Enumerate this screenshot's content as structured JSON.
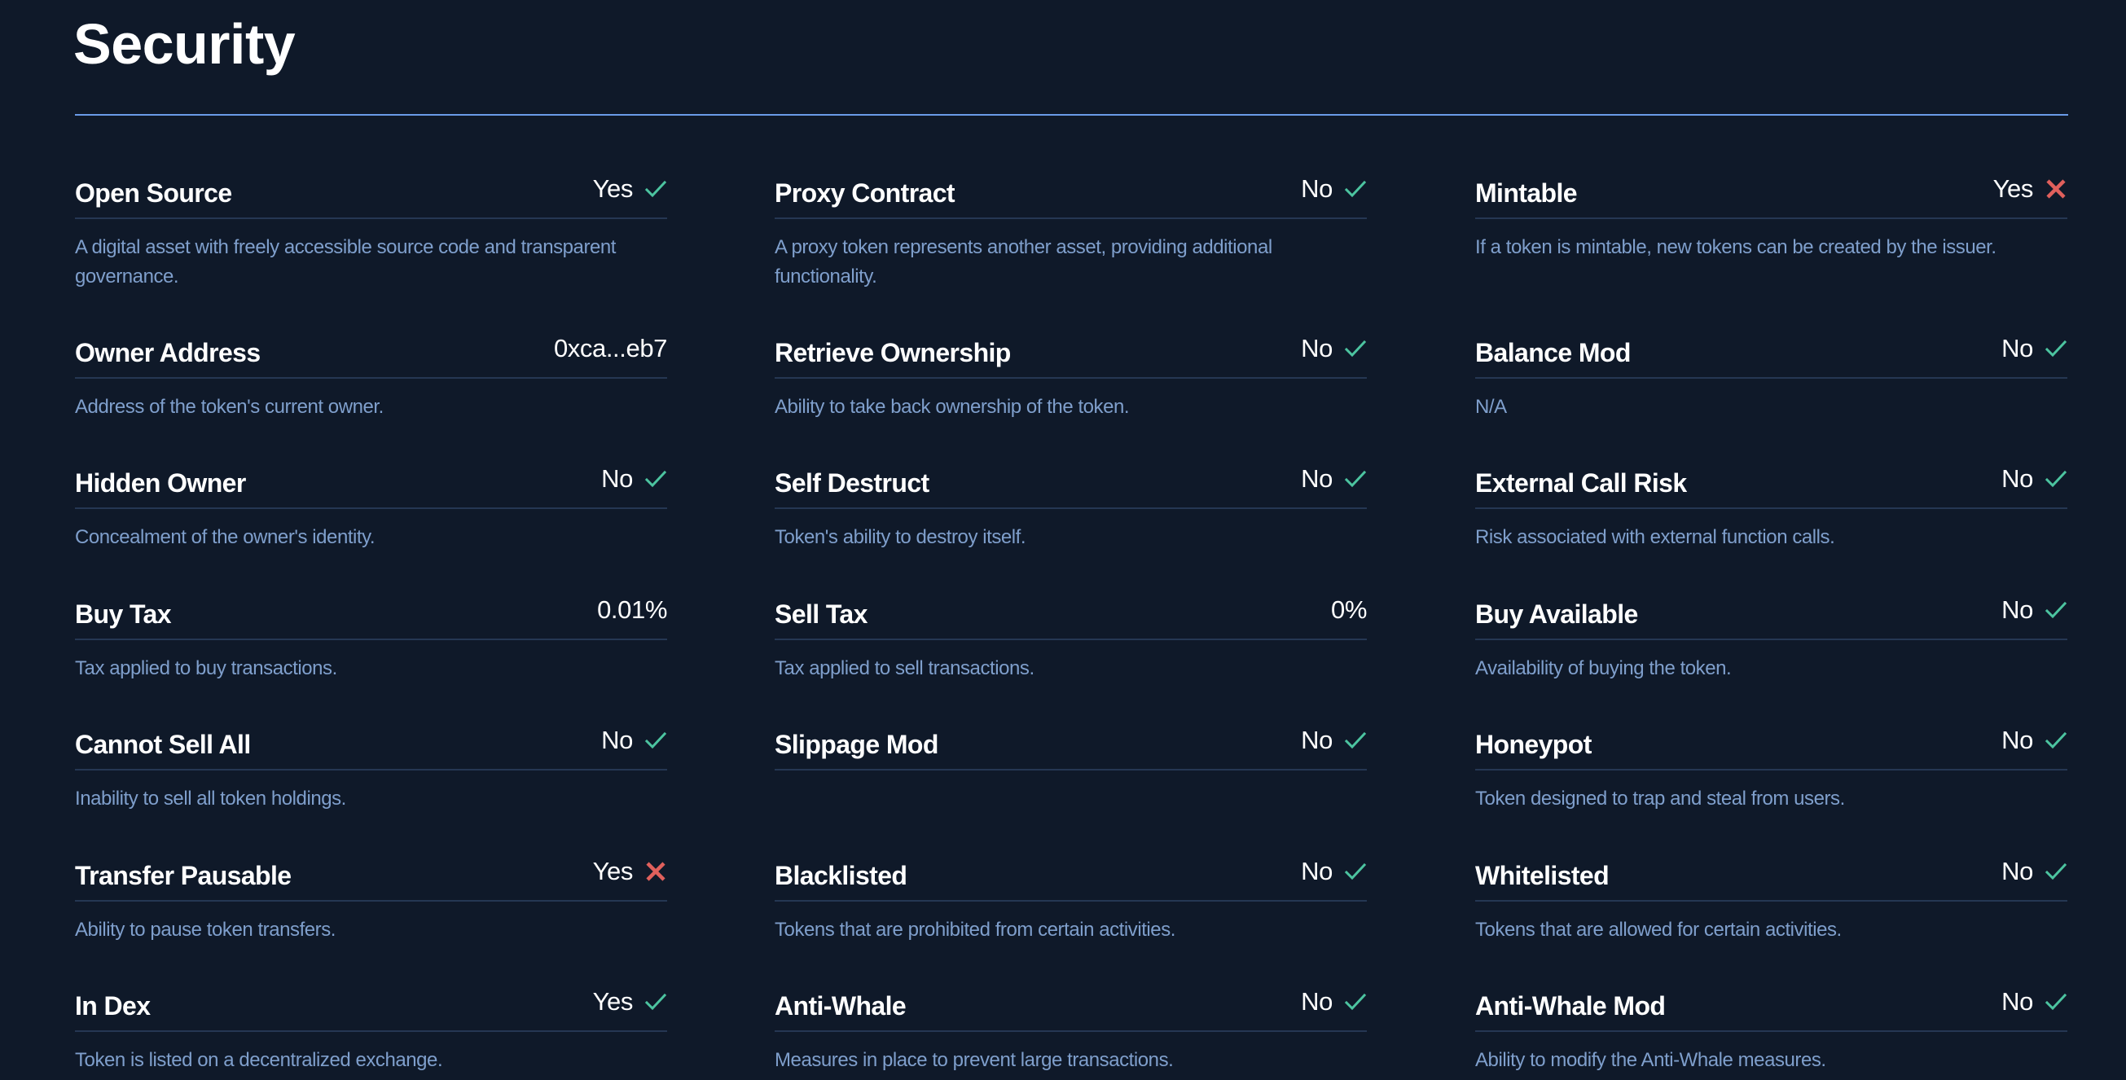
{
  "page": {
    "title": "Security"
  },
  "colors": {
    "background": "#0f1929",
    "accent_rule": "#6a9be8",
    "divider": "#253753",
    "label": "#ffffff",
    "description": "#7f9fcc",
    "pass": "#4cc4a0",
    "fail": "#e0605c"
  },
  "columns": [
    {
      "items": [
        {
          "label": "Open Source",
          "value": "Yes",
          "status": "pass",
          "icon": "check-icon",
          "description": "A digital asset with freely accessible source code and transparent governance."
        },
        {
          "label": "Owner Address",
          "value": "0xca...eb7",
          "status": "none",
          "icon": "",
          "description": "Address of the token's current owner."
        },
        {
          "label": "Hidden Owner",
          "value": "No",
          "status": "pass",
          "icon": "check-icon",
          "description": "Concealment of the owner's identity."
        },
        {
          "label": "Buy Tax",
          "value": "0.01%",
          "status": "none",
          "icon": "",
          "description": "Tax applied to buy transactions."
        },
        {
          "label": "Cannot Sell All",
          "value": "No",
          "status": "pass",
          "icon": "check-icon",
          "description": "Inability to sell all token holdings."
        },
        {
          "label": "Transfer Pausable",
          "value": "Yes",
          "status": "fail",
          "icon": "x-icon",
          "description": "Ability to pause token transfers."
        },
        {
          "label": "In Dex",
          "value": "Yes",
          "status": "pass",
          "icon": "check-icon",
          "description": "Token is listed on a decentralized exchange."
        }
      ]
    },
    {
      "items": [
        {
          "label": "Proxy Contract",
          "value": "No",
          "status": "pass",
          "icon": "check-icon",
          "description": "A proxy token represents another asset, providing additional functionality."
        },
        {
          "label": "Retrieve Ownership",
          "value": "No",
          "status": "pass",
          "icon": "check-icon",
          "description": "Ability to take back ownership of the token."
        },
        {
          "label": "Self Destruct",
          "value": "No",
          "status": "pass",
          "icon": "check-icon",
          "description": "Token's ability to destroy itself."
        },
        {
          "label": "Sell Tax",
          "value": "0%",
          "status": "none",
          "icon": "",
          "description": "Tax applied to sell transactions."
        },
        {
          "label": "Slippage Mod",
          "value": "No",
          "status": "pass",
          "icon": "check-icon",
          "description": ""
        },
        {
          "label": "Blacklisted",
          "value": "No",
          "status": "pass",
          "icon": "check-icon",
          "description": "Tokens that are prohibited from certain activities."
        },
        {
          "label": "Anti-Whale",
          "value": "No",
          "status": "pass",
          "icon": "check-icon",
          "description": "Measures in place to prevent large transactions."
        }
      ]
    },
    {
      "items": [
        {
          "label": "Mintable",
          "value": "Yes",
          "status": "fail",
          "icon": "x-icon",
          "description": "If a token is mintable, new tokens can be created by the issuer."
        },
        {
          "label": "Balance Mod",
          "value": "No",
          "status": "pass",
          "icon": "check-icon",
          "description": "N/A"
        },
        {
          "label": "External Call Risk",
          "value": "No",
          "status": "pass",
          "icon": "check-icon",
          "description": "Risk associated with external function calls."
        },
        {
          "label": "Buy Available",
          "value": "No",
          "status": "pass",
          "icon": "check-icon",
          "description": "Availability of buying the token."
        },
        {
          "label": "Honeypot",
          "value": "No",
          "status": "pass",
          "icon": "check-icon",
          "description": "Token designed to trap and steal from users."
        },
        {
          "label": "Whitelisted",
          "value": "No",
          "status": "pass",
          "icon": "check-icon",
          "description": "Tokens that are allowed for certain activities."
        },
        {
          "label": "Anti-Whale Mod",
          "value": "No",
          "status": "pass",
          "icon": "check-icon",
          "description": "Ability to modify the Anti-Whale measures."
        }
      ]
    }
  ]
}
